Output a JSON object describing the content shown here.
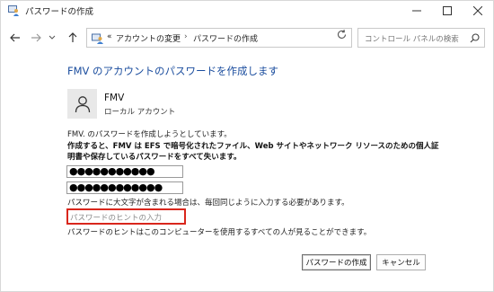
{
  "window": {
    "title": "パスワードの作成",
    "icon": "control-panel-users-icon",
    "controls": [
      "minimize-icon",
      "maximize-icon",
      "close-icon"
    ]
  },
  "address_bar": {
    "overflow": "«",
    "crumbs": [
      "アカウントの変更",
      "パスワードの作成"
    ],
    "separator": "›",
    "search_placeholder": "コントロール パネルの検索"
  },
  "main": {
    "heading": "FMV のアカウントのパスワードを作成します",
    "user": {
      "name": "FMV",
      "type": "ローカル アカウント"
    },
    "info": "FMV. のパスワードを作成しようとしています。",
    "warning": "作成すると、FMV は EFS で暗号化されたファイル、Web サイトやネットワーク リソースのための個人証明書や保存しているパスワードをすべて失います。",
    "new_password": "●●●●●●●●●●●",
    "confirm_password": "●●●●●●●●●●●●",
    "case_note": "パスワードに大文字が含まれる場合は、毎回同じように入力する必要があります。",
    "hint_placeholder": "パスワードのヒントの入力",
    "hint_note": "パスワードのヒントはこのコンピューターを使用するすべての人が見ることができます。",
    "hint_highlight_color": "#d9261c",
    "heading_color": "#1b4d9e"
  },
  "buttons": {
    "create": "パスワードの作成",
    "cancel": "キャンセル"
  }
}
